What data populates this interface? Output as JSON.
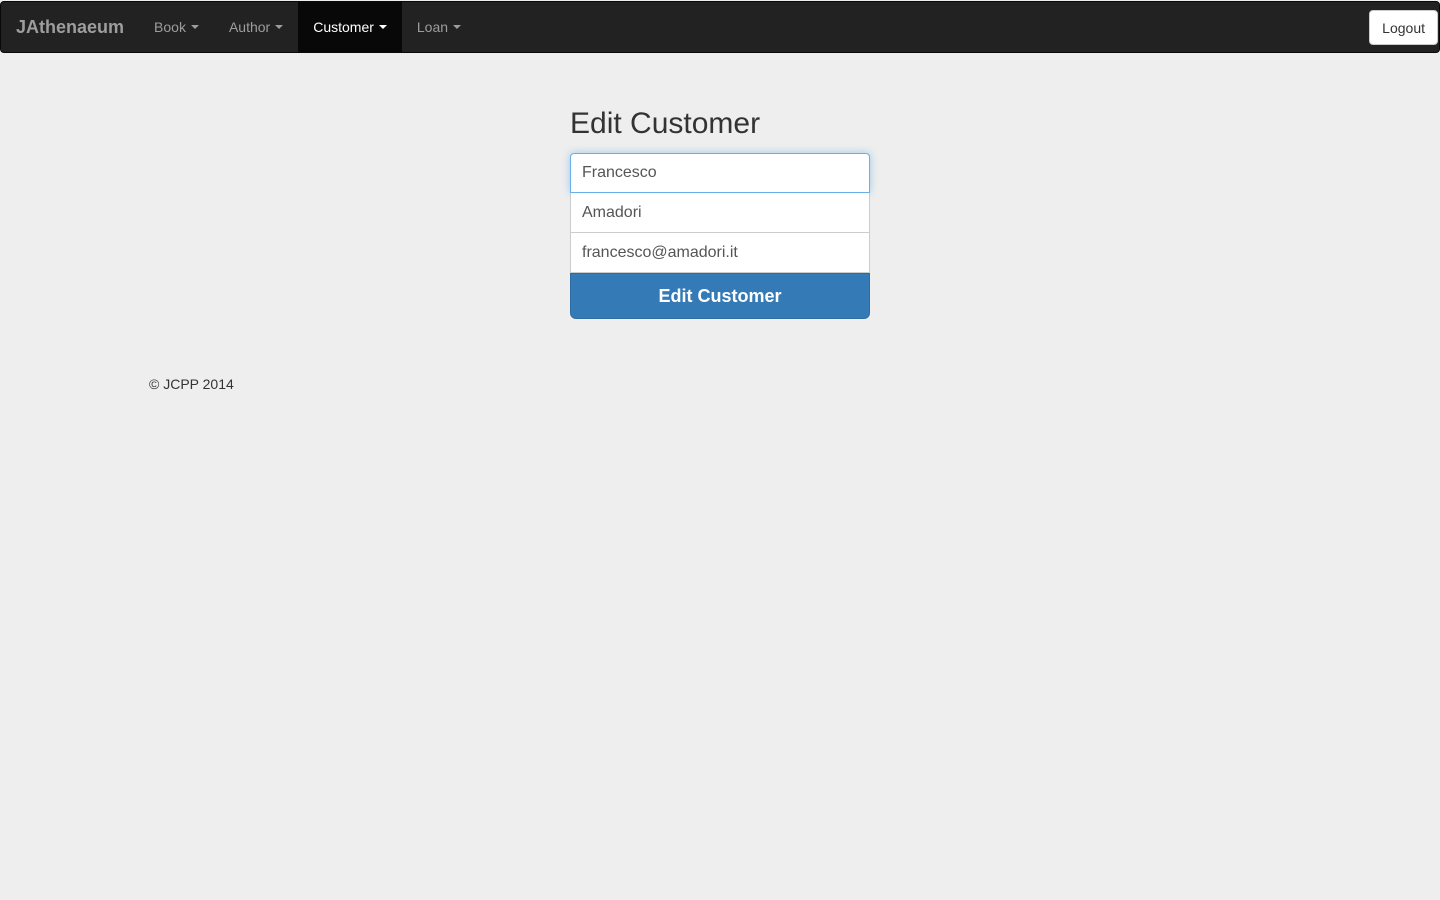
{
  "nav": {
    "brand": "JAthenaeum",
    "items": [
      {
        "label": "Book"
      },
      {
        "label": "Author"
      },
      {
        "label": "Customer",
        "active": true
      },
      {
        "label": "Loan"
      }
    ],
    "logout": "Logout"
  },
  "form": {
    "title": "Edit Customer",
    "first_name": "Francesco",
    "last_name": "Amadori",
    "email": "francesco@amadori.it",
    "submit": "Edit Customer"
  },
  "footer": {
    "text": "© JCPP 2014"
  },
  "colors": {
    "navbar": "#222222",
    "primary": "#337ab7",
    "background": "#eeeeee"
  }
}
